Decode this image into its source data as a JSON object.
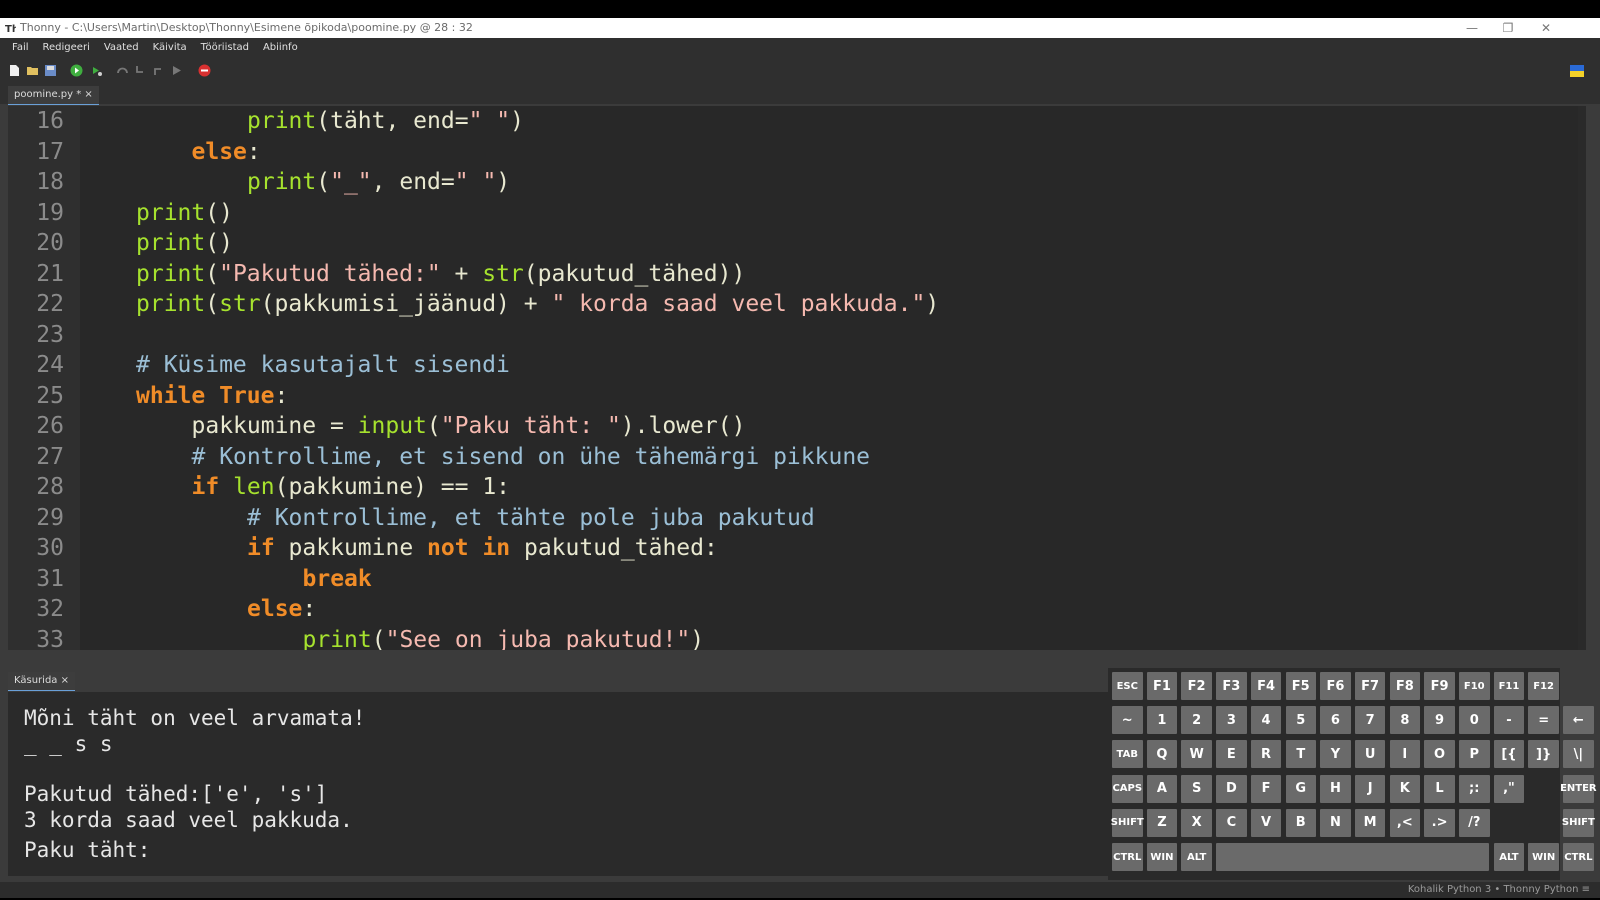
{
  "window": {
    "title": "Thonny  -  C:\\Users\\Martin\\Desktop\\Thonny\\Esimene õpikoda\\poomine.py  @  28 : 32"
  },
  "menu": [
    "Fail",
    "Redigeeri",
    "Vaated",
    "Käivita",
    "Tööriistad",
    "Abiinfo"
  ],
  "editor_tab": "poomine.py * ×",
  "code_lines": [
    {
      "n": "16",
      "indent": 2,
      "tokens": [
        {
          "t": "print",
          "c": "fn"
        },
        {
          "t": "(täht, end="
        },
        {
          "t": "\" \"",
          "c": "st"
        },
        {
          "t": ")"
        }
      ]
    },
    {
      "n": "17",
      "indent": 1,
      "tokens": [
        {
          "t": "else",
          "c": "kw"
        },
        {
          "t": ":"
        }
      ]
    },
    {
      "n": "18",
      "indent": 2,
      "tokens": [
        {
          "t": "print",
          "c": "fn"
        },
        {
          "t": "("
        },
        {
          "t": "\"_\"",
          "c": "st"
        },
        {
          "t": ", end="
        },
        {
          "t": "\" \"",
          "c": "st"
        },
        {
          "t": ")"
        }
      ]
    },
    {
      "n": "19",
      "indent": 0,
      "tokens": [
        {
          "t": "print",
          "c": "fn"
        },
        {
          "t": "()"
        }
      ]
    },
    {
      "n": "20",
      "indent": 0,
      "tokens": [
        {
          "t": "print",
          "c": "fn"
        },
        {
          "t": "()"
        }
      ]
    },
    {
      "n": "21",
      "indent": 0,
      "tokens": [
        {
          "t": "print",
          "c": "fn"
        },
        {
          "t": "("
        },
        {
          "t": "\"Pakutud tähed:\"",
          "c": "st"
        },
        {
          "t": " + "
        },
        {
          "t": "str",
          "c": "fn"
        },
        {
          "t": "(pakutud_tähed))"
        }
      ]
    },
    {
      "n": "22",
      "indent": 0,
      "tokens": [
        {
          "t": "print",
          "c": "fn"
        },
        {
          "t": "("
        },
        {
          "t": "str",
          "c": "fn"
        },
        {
          "t": "(pakkumisi_jäänud) + "
        },
        {
          "t": "\" korda saad veel pakkuda.\"",
          "c": "st"
        },
        {
          "t": ")"
        }
      ]
    },
    {
      "n": "23",
      "indent": 0,
      "tokens": []
    },
    {
      "n": "24",
      "indent": 0,
      "tokens": [
        {
          "t": "# Küsime kasutajalt sisendi",
          "c": "cm"
        }
      ]
    },
    {
      "n": "25",
      "indent": 0,
      "tokens": [
        {
          "t": "while",
          "c": "kw"
        },
        {
          "t": " "
        },
        {
          "t": "True",
          "c": "kw"
        },
        {
          "t": ":"
        }
      ]
    },
    {
      "n": "26",
      "indent": 1,
      "tokens": [
        {
          "t": "pakkumine = "
        },
        {
          "t": "input",
          "c": "fn"
        },
        {
          "t": "("
        },
        {
          "t": "\"Paku täht: \"",
          "c": "st"
        },
        {
          "t": ").lower()"
        }
      ]
    },
    {
      "n": "27",
      "indent": 1,
      "tokens": [
        {
          "t": "# Kontrollime, et sisend on ühe tähemärgi pikkune",
          "c": "cm"
        }
      ]
    },
    {
      "n": "28",
      "indent": 1,
      "tokens": [
        {
          "t": "if",
          "c": "kw"
        },
        {
          "t": " "
        },
        {
          "t": "len",
          "c": "fn"
        },
        {
          "t": "(pakkumine) == 1:"
        }
      ]
    },
    {
      "n": "29",
      "indent": 2,
      "tokens": [
        {
          "t": "# Kontrollime, et tähte pole juba pakutud",
          "c": "cm"
        }
      ]
    },
    {
      "n": "30",
      "indent": 2,
      "tokens": [
        {
          "t": "if",
          "c": "kw"
        },
        {
          "t": " pakkumine "
        },
        {
          "t": "not",
          "c": "kw"
        },
        {
          "t": " "
        },
        {
          "t": "in",
          "c": "kw"
        },
        {
          "t": " pakutud_tähed:"
        }
      ]
    },
    {
      "n": "31",
      "indent": 3,
      "tokens": [
        {
          "t": "break",
          "c": "kw"
        }
      ]
    },
    {
      "n": "32",
      "indent": 2,
      "tokens": [
        {
          "t": "else",
          "c": "kw"
        },
        {
          "t": ":"
        }
      ]
    },
    {
      "n": "33",
      "indent": 3,
      "tokens": [
        {
          "t": "print",
          "c": "fn"
        },
        {
          "t": "("
        },
        {
          "t": "\"See on juba pakutud!\"",
          "c": "st"
        },
        {
          "t": ")"
        }
      ]
    }
  ],
  "shell_tab": "Käsurida ×",
  "shell_lines": [
    "Mõni täht on veel arvamata!",
    "_ _ s s",
    "",
    "Pakutud tähed:['e', 's']",
    "3 korda saad veel pakkuda.",
    "Paku täht: "
  ],
  "keyboard_rows": [
    [
      "ESC",
      "F1",
      "F2",
      "F3",
      "F4",
      "F5",
      "F6",
      "F7",
      "F8",
      "F9",
      "F10",
      "F11",
      "F12"
    ],
    [
      "~",
      "1",
      "2",
      "3",
      "4",
      "5",
      "6",
      "7",
      "8",
      "9",
      "0",
      "-",
      "="
    ],
    [
      "TAB",
      "Q",
      "W",
      "E",
      "R",
      "T",
      "Y",
      "U",
      "I",
      "O",
      "P",
      "[{",
      "]}"
    ],
    [
      "CAPS",
      "A",
      "S",
      "D",
      "F",
      "G",
      "H",
      "J",
      "K",
      "L",
      ";:",
      ",\""
    ],
    [
      "SHIFT",
      "Z",
      "X",
      "C",
      "V",
      "B",
      "N",
      "M",
      ",<",
      ".>",
      "/?"
    ]
  ],
  "keyboard_extra": {
    "backspace": "←",
    "backslash": "\\|",
    "enter": "ENTER",
    "right_shift": "SHIFT",
    "bottom_left": [
      "CTRL",
      "WIN",
      "ALT"
    ],
    "bottom_right": [
      "ALT",
      "WIN",
      "CTRL"
    ]
  },
  "status": "Kohalik Python 3  •  Thonny Python  ≡",
  "colors": {
    "accent_tab": "#6aa0d8",
    "keyword": "#f08c28",
    "function": "#a6e22e",
    "string": "#f5b9b0",
    "comment": "#9bbfd6"
  }
}
